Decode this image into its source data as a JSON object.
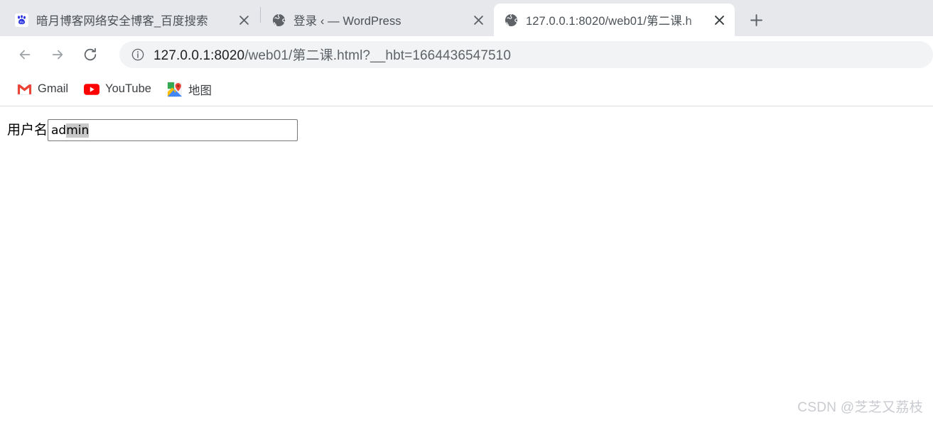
{
  "browser": {
    "tabs": [
      {
        "title": "暗月博客网络安全博客_百度搜索",
        "favicon": "baidu-favicon",
        "active": false,
        "close_label": "×"
      },
      {
        "title": "登录 ‹ — WordPress",
        "favicon": "globe-icon",
        "active": false,
        "close_label": "×"
      },
      {
        "title": "127.0.0.1:8020/web01/第二课.h",
        "favicon": "globe-icon",
        "active": true,
        "close_label": "×"
      }
    ],
    "new_tab_label": "+",
    "toolbar": {
      "back_icon": "back-arrow-icon",
      "forward_icon": "forward-arrow-icon",
      "reload_icon": "reload-icon",
      "site_info_icon": "info-circle-icon",
      "url_host": "127.0.0.1:8020",
      "url_path": "/web01/第二课.html?__hbt=1664436547510",
      "url_full": "127.0.0.1:8020/web01/第二课.html?__hbt=1664436547510"
    },
    "bookmarks": [
      {
        "label": "Gmail",
        "icon": "gmail-icon"
      },
      {
        "label": "YouTube",
        "icon": "youtube-icon"
      },
      {
        "label": "地图",
        "icon": "google-maps-icon"
      }
    ]
  },
  "page": {
    "form": {
      "label": "用户名",
      "input_value": "admin",
      "input_value_unselected": "ad",
      "input_value_selected": "min",
      "placeholder": ""
    }
  },
  "watermark": {
    "text": "CSDN @芝芝又荔枝"
  },
  "colors": {
    "tabstrip_bg": "#e7e8ec",
    "active_tab_bg": "#ffffff",
    "omnibox_bg": "#f1f3f4",
    "selection_bg": "#c8c8c8",
    "watermark": "#c9cbd0"
  }
}
